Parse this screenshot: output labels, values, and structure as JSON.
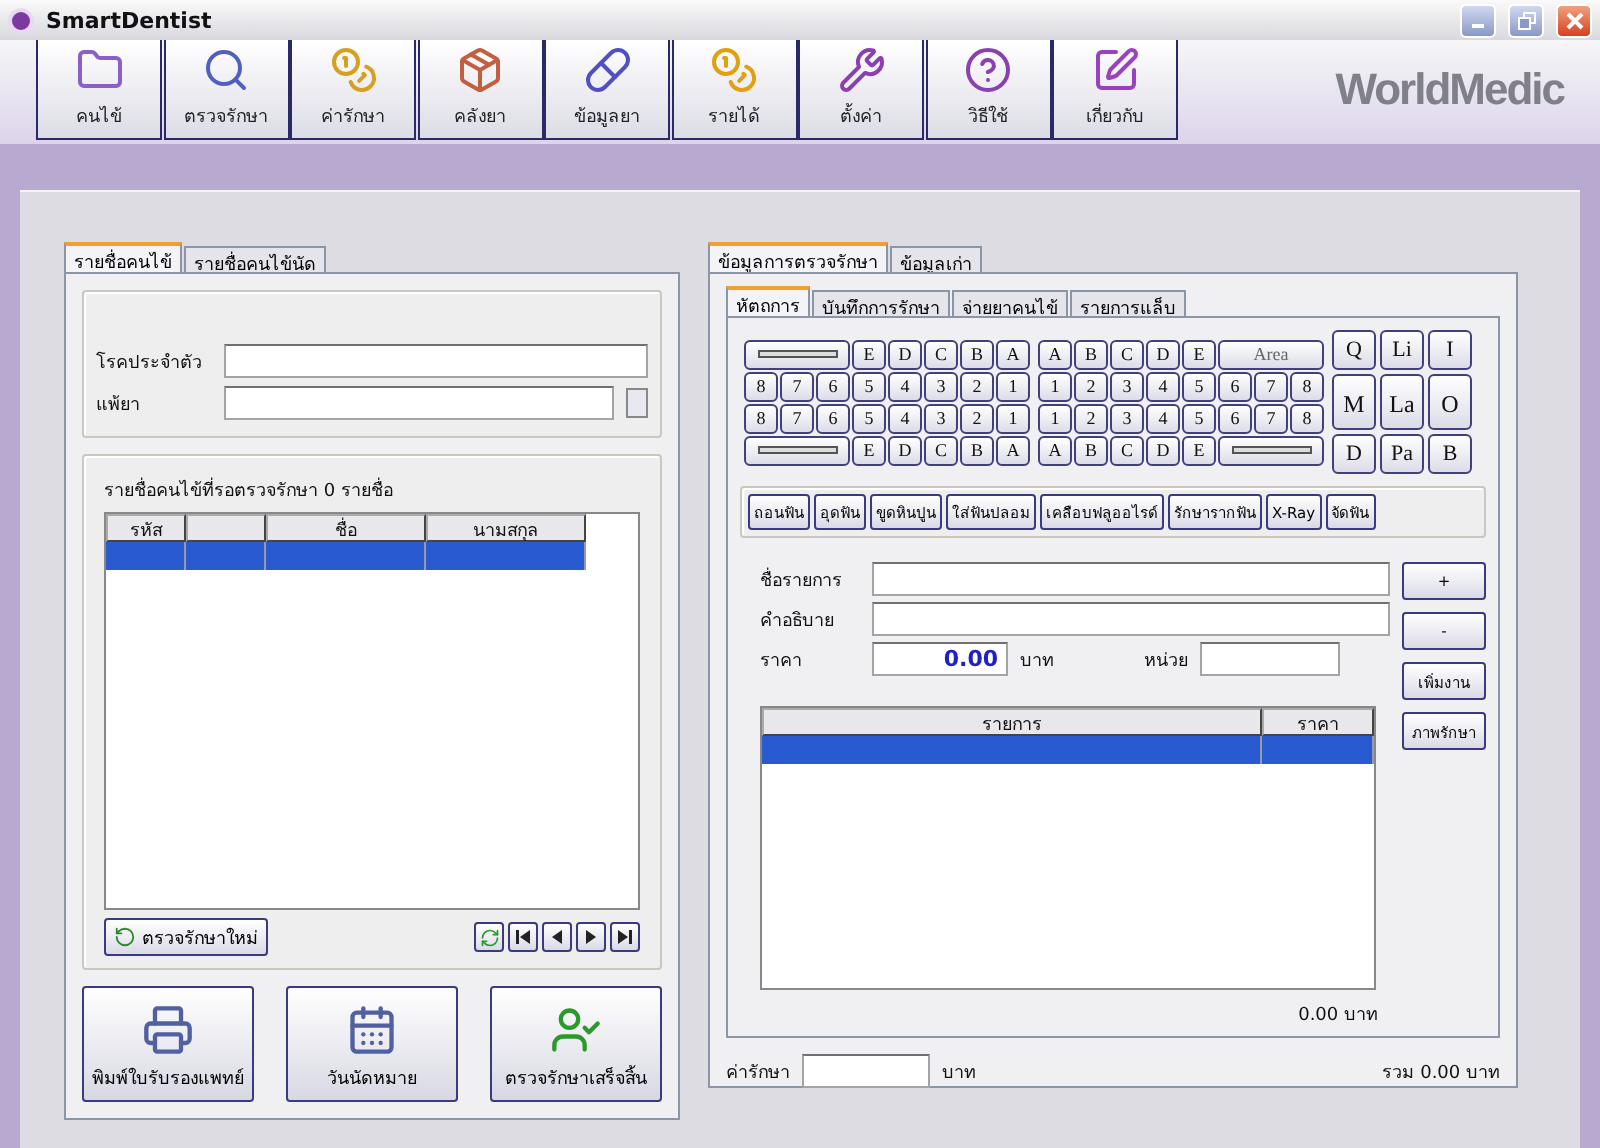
{
  "window": {
    "title": "SmartDentist",
    "controls": [
      {
        "kind": "minimize"
      },
      {
        "kind": "restore"
      },
      {
        "kind": "close"
      }
    ]
  },
  "toolbar": [
    {
      "label": "คนไข้",
      "kind": "folder"
    },
    {
      "label": "ตรวจรักษา",
      "kind": "search"
    },
    {
      "label": "ค่ารักษา",
      "kind": "coins-window"
    },
    {
      "label": "คลังยา",
      "kind": "box"
    },
    {
      "label": "ข้อมูลยา",
      "kind": "pill"
    },
    {
      "label": "รายได้",
      "kind": "coins"
    },
    {
      "label": "ตั้งค่า",
      "kind": "tools"
    },
    {
      "label": "วิธีใช้",
      "kind": "help"
    },
    {
      "label": "เกี่ยวกับ",
      "kind": "about"
    }
  ],
  "logo": "WorldMedic",
  "left_panel": {
    "tabs": [
      {
        "label": "รายชื่อคนไข้",
        "selected": true
      },
      {
        "label": "รายชื่อคนไข้นัด",
        "selected": false
      }
    ],
    "fields": [
      {
        "label": "โรคประจำตัว",
        "kind": "text"
      },
      {
        "label": "แพ้ยา",
        "kind": "spin"
      }
    ],
    "waiting_list": {
      "title": "รายชื่อคนไข้ที่รอตรวจรักษา 0 รายชื่อ",
      "columns": [
        {
          "kind": "text",
          "label": "รหัส"
        },
        {
          "kind": "blank"
        },
        {
          "kind": "text",
          "label": "ชื่อ"
        },
        {
          "kind": "text",
          "label": "นามสกุล"
        }
      ],
      "rows": [
        {
          "selected": true
        }
      ]
    },
    "new_exam_button": "ตรวจรักษาใหม่",
    "pager": [
      {
        "kind": "refresh"
      },
      {
        "kind": "first"
      },
      {
        "kind": "prev"
      },
      {
        "kind": "next"
      },
      {
        "kind": "last"
      }
    ],
    "actions": [
      {
        "label": "พิมพ์ใบรับรองแพทย์",
        "kind": "printer"
      },
      {
        "label": "วันนัดหมาย",
        "kind": "calendar"
      },
      {
        "label": "ตรวจรักษาเสร็จสิ้น",
        "kind": "done"
      }
    ]
  },
  "right_panel": {
    "tabs": [
      {
        "label": "ข้อมูลการตรวจรักษา",
        "selected": true
      },
      {
        "label": "ข้อมูลเก่า",
        "selected": false
      }
    ],
    "sub_tabs": [
      {
        "label": "หัตถการ",
        "selected": true
      },
      {
        "label": "บันทึกการรักษา",
        "selected": false
      },
      {
        "label": "จ่ายยาคนไข้",
        "selected": false
      },
      {
        "label": "รายการแล็บ",
        "selected": false
      }
    ],
    "tooth_chart": {
      "left": [
        [
          {
            "kind": "bar"
          },
          {
            "kind": "key",
            "label": "E"
          },
          {
            "kind": "key",
            "label": "D"
          },
          {
            "kind": "key",
            "label": "C"
          },
          {
            "kind": "key",
            "label": "B"
          },
          {
            "kind": "key",
            "label": "A"
          }
        ],
        [
          {
            "kind": "key",
            "label": "8"
          },
          {
            "kind": "key",
            "label": "7"
          },
          {
            "kind": "key",
            "label": "6"
          },
          {
            "kind": "key",
            "label": "5"
          },
          {
            "kind": "key",
            "label": "4"
          },
          {
            "kind": "key",
            "label": "3"
          },
          {
            "kind": "key",
            "label": "2"
          },
          {
            "kind": "key",
            "label": "1"
          }
        ],
        [
          {
            "kind": "key",
            "label": "8"
          },
          {
            "kind": "key",
            "label": "7"
          },
          {
            "kind": "key",
            "label": "6"
          },
          {
            "kind": "key",
            "label": "5"
          },
          {
            "kind": "key",
            "label": "4"
          },
          {
            "kind": "key",
            "label": "3"
          },
          {
            "kind": "key",
            "label": "2"
          },
          {
            "kind": "key",
            "label": "1"
          }
        ],
        [
          {
            "kind": "bar"
          },
          {
            "kind": "key",
            "label": "E"
          },
          {
            "kind": "key",
            "label": "D"
          },
          {
            "kind": "key",
            "label": "C"
          },
          {
            "kind": "key",
            "label": "B"
          },
          {
            "kind": "key",
            "label": "A"
          }
        ]
      ],
      "right": [
        [
          {
            "kind": "key",
            "label": "A"
          },
          {
            "kind": "key",
            "label": "B"
          },
          {
            "kind": "key",
            "label": "C"
          },
          {
            "kind": "key",
            "label": "D"
          },
          {
            "kind": "key",
            "label": "E"
          },
          {
            "kind": "wide",
            "label": "Area"
          }
        ],
        [
          {
            "kind": "key",
            "label": "1"
          },
          {
            "kind": "key",
            "label": "2"
          },
          {
            "kind": "key",
            "label": "3"
          },
          {
            "kind": "key",
            "label": "4"
          },
          {
            "kind": "key",
            "label": "5"
          },
          {
            "kind": "key",
            "label": "6"
          },
          {
            "kind": "key",
            "label": "7"
          },
          {
            "kind": "key",
            "label": "8"
          }
        ],
        [
          {
            "kind": "key",
            "label": "1"
          },
          {
            "kind": "key",
            "label": "2"
          },
          {
            "kind": "key",
            "label": "3"
          },
          {
            "kind": "key",
            "label": "4"
          },
          {
            "kind": "key",
            "label": "5"
          },
          {
            "kind": "key",
            "label": "6"
          },
          {
            "kind": "key",
            "label": "7"
          },
          {
            "kind": "key",
            "label": "8"
          }
        ],
        [
          {
            "kind": "key",
            "label": "A"
          },
          {
            "kind": "key",
            "label": "B"
          },
          {
            "kind": "key",
            "label": "C"
          },
          {
            "kind": "key",
            "label": "D"
          },
          {
            "kind": "key",
            "label": "E"
          },
          {
            "kind": "bar"
          }
        ]
      ],
      "surfaces": [
        {
          "label": "Q",
          "kind": "key"
        },
        {
          "label": "Li",
          "kind": "key"
        },
        {
          "label": "I",
          "kind": "key"
        },
        {
          "label": "M",
          "kind": "tall"
        },
        {
          "label": "La",
          "kind": "tall"
        },
        {
          "label": "O",
          "kind": "tall"
        },
        {
          "label": "D",
          "kind": "key"
        },
        {
          "label": "Pa",
          "kind": "key"
        },
        {
          "label": "B",
          "kind": "key"
        }
      ]
    },
    "procedures": [
      "ถอนฟัน",
      "อุดฟัน",
      "ขูดหินปูน",
      "ใส่ฟันปลอม",
      "เคลือบฟลูออไรด์",
      "รักษารากฟัน",
      "X-Ray",
      "จัดฟัน"
    ],
    "form": {
      "item_label": "ชื่อรายการ",
      "description_label": "คำอธิบาย",
      "price_label": "ราคา",
      "price_value": "0.00",
      "price_unit": "บาท",
      "quantity_label": "หน่วย"
    },
    "side_buttons": [
      "+",
      "-",
      "เพิ่มงาน",
      "ภาพรักษา"
    ],
    "items_table": {
      "columns": [
        "รายการ",
        "ราคา"
      ],
      "rows": [
        {
          "selected": true
        }
      ]
    },
    "subtotal": "0.00 บาท",
    "fee_label": "ค่ารักษา",
    "fee_unit": "บาท",
    "total": "รวม 0.00 บาท"
  }
}
